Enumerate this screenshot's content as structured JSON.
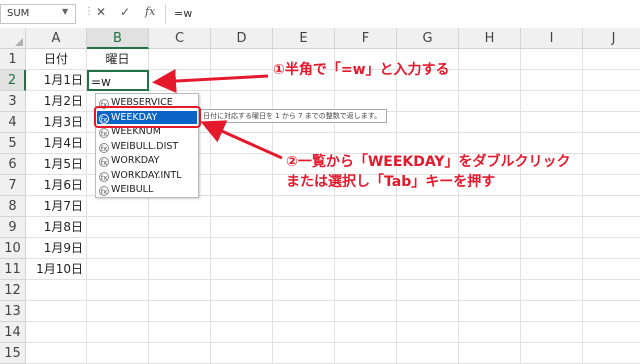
{
  "formula_bar": {
    "namebox": "SUM",
    "formula": "=w",
    "cancel_icon": "✕",
    "enter_icon": "✓",
    "fx_label": "fx"
  },
  "columns": [
    "A",
    "B",
    "C",
    "D",
    "E",
    "F",
    "G",
    "H",
    "I",
    "J"
  ],
  "rows": [
    "1",
    "2",
    "3",
    "4",
    "5",
    "6",
    "7",
    "8",
    "9",
    "10",
    "11",
    "12",
    "13",
    "14",
    "15"
  ],
  "cells": {
    "A1": "日付",
    "B1": "曜日",
    "A2": "1月1日",
    "B2": "=w",
    "A3": "1月2日",
    "A4": "1月3日",
    "A5": "1月4日",
    "A6": "1月5日",
    "A7": "1月6日",
    "A8": "1月7日",
    "A9": "1月8日",
    "A10": "1月9日",
    "A11": "1月10日"
  },
  "autocomplete": {
    "items": [
      "WEBSERVICE",
      "WEEKDAY",
      "WEEKNUM",
      "WEIBULL.DIST",
      "WORKDAY",
      "WORKDAY.INTL",
      "WEIBULL"
    ],
    "selected_index": 1,
    "tooltip": "日付に対応する曜日を 1 から 7 までの整数で返します。"
  },
  "annotations": {
    "step1": "①半角で「=w」と入力する",
    "step2_line1": "②一覧から「WEEKDAY」をダブルクリック",
    "step2_line2": "または選択し「Tab」キーを押す"
  },
  "colors": {
    "accent_green": "#217346",
    "annotation_red": "#e4192c",
    "selection_blue": "#0a64c8"
  }
}
